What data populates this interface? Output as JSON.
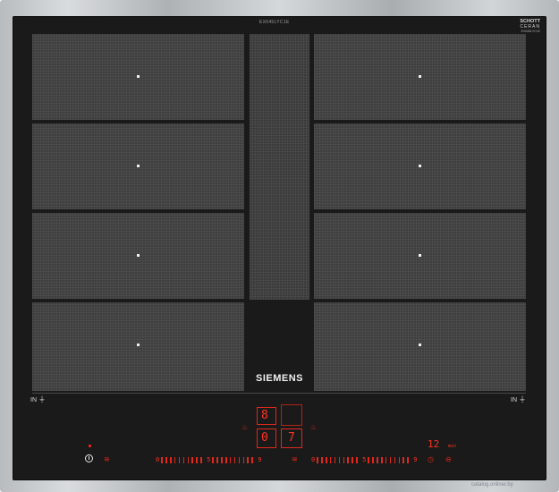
{
  "product": {
    "model": "EX645LYC1E",
    "brand": "SIEMENS",
    "glass_brand": {
      "line1": "SCHOTT",
      "line2": "CERAN",
      "line3": "EX645LYC1E"
    }
  },
  "zones": {
    "left": [
      {
        "name": "zone-left-1"
      },
      {
        "name": "zone-left-2"
      },
      {
        "name": "zone-left-3"
      },
      {
        "name": "zone-left-4"
      }
    ],
    "right": [
      {
        "name": "zone-right-1"
      },
      {
        "name": "zone-right-2"
      },
      {
        "name": "zone-right-3"
      },
      {
        "name": "zone-right-4"
      }
    ]
  },
  "labels": {
    "in_left": "IN",
    "in_right": "IN",
    "in_symbol": "⏚"
  },
  "controls": {
    "display_top": "8",
    "display_bottom": "0",
    "display_right": "7",
    "timer_value": "12",
    "timer_unit": "min",
    "slider_left_marks": [
      "0",
      "5",
      "9"
    ],
    "slider_right_marks": [
      "0",
      "5",
      "9"
    ]
  },
  "icons": {
    "power": "power-icon",
    "timer": "timer-icon",
    "heat": "heat-icon"
  },
  "watermark": "catalog.onliner.by",
  "colors": {
    "glass": "#1a1a1a",
    "zone": "#3e3e3e",
    "control_red": "#ff2a1a",
    "frame": "#c4c8ca"
  }
}
